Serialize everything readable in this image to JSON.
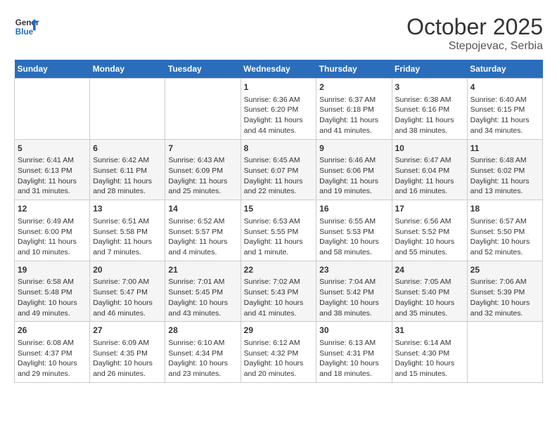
{
  "header": {
    "logo_general": "General",
    "logo_blue": "Blue",
    "month": "October 2025",
    "location": "Stepojevac, Serbia"
  },
  "weekdays": [
    "Sunday",
    "Monday",
    "Tuesday",
    "Wednesday",
    "Thursday",
    "Friday",
    "Saturday"
  ],
  "weeks": [
    [
      {
        "day": "",
        "info": ""
      },
      {
        "day": "",
        "info": ""
      },
      {
        "day": "",
        "info": ""
      },
      {
        "day": "1",
        "info": "Sunrise: 6:36 AM\nSunset: 6:20 PM\nDaylight: 11 hours and 44 minutes."
      },
      {
        "day": "2",
        "info": "Sunrise: 6:37 AM\nSunset: 6:18 PM\nDaylight: 11 hours and 41 minutes."
      },
      {
        "day": "3",
        "info": "Sunrise: 6:38 AM\nSunset: 6:16 PM\nDaylight: 11 hours and 38 minutes."
      },
      {
        "day": "4",
        "info": "Sunrise: 6:40 AM\nSunset: 6:15 PM\nDaylight: 11 hours and 34 minutes."
      }
    ],
    [
      {
        "day": "5",
        "info": "Sunrise: 6:41 AM\nSunset: 6:13 PM\nDaylight: 11 hours and 31 minutes."
      },
      {
        "day": "6",
        "info": "Sunrise: 6:42 AM\nSunset: 6:11 PM\nDaylight: 11 hours and 28 minutes."
      },
      {
        "day": "7",
        "info": "Sunrise: 6:43 AM\nSunset: 6:09 PM\nDaylight: 11 hours and 25 minutes."
      },
      {
        "day": "8",
        "info": "Sunrise: 6:45 AM\nSunset: 6:07 PM\nDaylight: 11 hours and 22 minutes."
      },
      {
        "day": "9",
        "info": "Sunrise: 6:46 AM\nSunset: 6:06 PM\nDaylight: 11 hours and 19 minutes."
      },
      {
        "day": "10",
        "info": "Sunrise: 6:47 AM\nSunset: 6:04 PM\nDaylight: 11 hours and 16 minutes."
      },
      {
        "day": "11",
        "info": "Sunrise: 6:48 AM\nSunset: 6:02 PM\nDaylight: 11 hours and 13 minutes."
      }
    ],
    [
      {
        "day": "12",
        "info": "Sunrise: 6:49 AM\nSunset: 6:00 PM\nDaylight: 11 hours and 10 minutes."
      },
      {
        "day": "13",
        "info": "Sunrise: 6:51 AM\nSunset: 5:58 PM\nDaylight: 11 hours and 7 minutes."
      },
      {
        "day": "14",
        "info": "Sunrise: 6:52 AM\nSunset: 5:57 PM\nDaylight: 11 hours and 4 minutes."
      },
      {
        "day": "15",
        "info": "Sunrise: 6:53 AM\nSunset: 5:55 PM\nDaylight: 11 hours and 1 minute."
      },
      {
        "day": "16",
        "info": "Sunrise: 6:55 AM\nSunset: 5:53 PM\nDaylight: 10 hours and 58 minutes."
      },
      {
        "day": "17",
        "info": "Sunrise: 6:56 AM\nSunset: 5:52 PM\nDaylight: 10 hours and 55 minutes."
      },
      {
        "day": "18",
        "info": "Sunrise: 6:57 AM\nSunset: 5:50 PM\nDaylight: 10 hours and 52 minutes."
      }
    ],
    [
      {
        "day": "19",
        "info": "Sunrise: 6:58 AM\nSunset: 5:48 PM\nDaylight: 10 hours and 49 minutes."
      },
      {
        "day": "20",
        "info": "Sunrise: 7:00 AM\nSunset: 5:47 PM\nDaylight: 10 hours and 46 minutes."
      },
      {
        "day": "21",
        "info": "Sunrise: 7:01 AM\nSunset: 5:45 PM\nDaylight: 10 hours and 43 minutes."
      },
      {
        "day": "22",
        "info": "Sunrise: 7:02 AM\nSunset: 5:43 PM\nDaylight: 10 hours and 41 minutes."
      },
      {
        "day": "23",
        "info": "Sunrise: 7:04 AM\nSunset: 5:42 PM\nDaylight: 10 hours and 38 minutes."
      },
      {
        "day": "24",
        "info": "Sunrise: 7:05 AM\nSunset: 5:40 PM\nDaylight: 10 hours and 35 minutes."
      },
      {
        "day": "25",
        "info": "Sunrise: 7:06 AM\nSunset: 5:39 PM\nDaylight: 10 hours and 32 minutes."
      }
    ],
    [
      {
        "day": "26",
        "info": "Sunrise: 6:08 AM\nSunset: 4:37 PM\nDaylight: 10 hours and 29 minutes."
      },
      {
        "day": "27",
        "info": "Sunrise: 6:09 AM\nSunset: 4:35 PM\nDaylight: 10 hours and 26 minutes."
      },
      {
        "day": "28",
        "info": "Sunrise: 6:10 AM\nSunset: 4:34 PM\nDaylight: 10 hours and 23 minutes."
      },
      {
        "day": "29",
        "info": "Sunrise: 6:12 AM\nSunset: 4:32 PM\nDaylight: 10 hours and 20 minutes."
      },
      {
        "day": "30",
        "info": "Sunrise: 6:13 AM\nSunset: 4:31 PM\nDaylight: 10 hours and 18 minutes."
      },
      {
        "day": "31",
        "info": "Sunrise: 6:14 AM\nSunset: 4:30 PM\nDaylight: 10 hours and 15 minutes."
      },
      {
        "day": "",
        "info": ""
      }
    ]
  ]
}
